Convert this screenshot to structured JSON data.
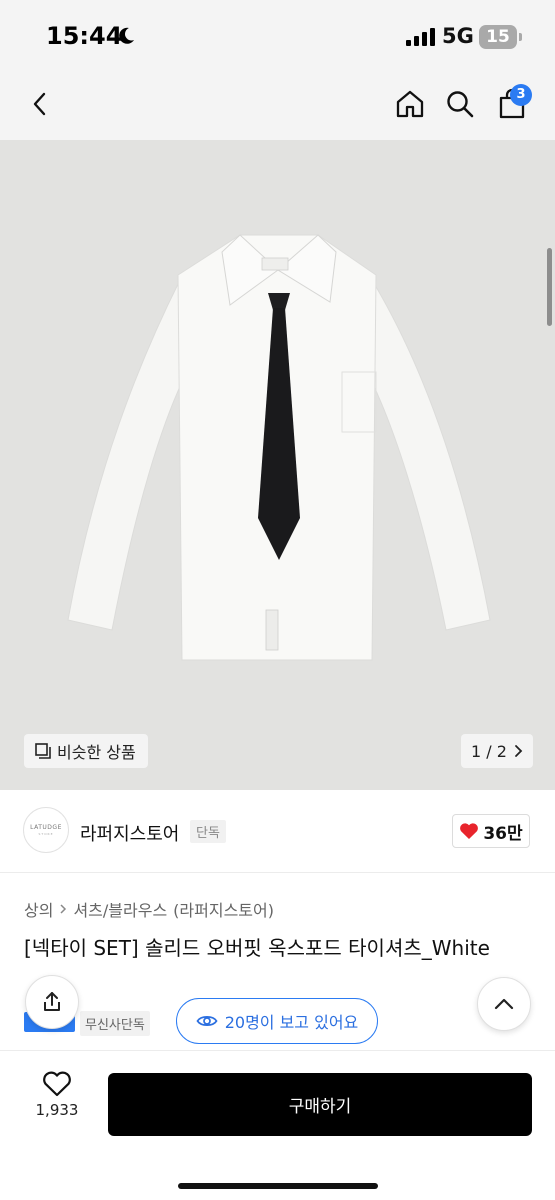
{
  "status_bar": {
    "time": "15:44",
    "network": "5G",
    "battery": "15"
  },
  "nav": {
    "cart_count": "3",
    "icons": [
      "back-chevron-icon",
      "home-icon",
      "search-icon",
      "shopping-bag-icon"
    ]
  },
  "gallery": {
    "similar_label": "비슷한 상품",
    "page_indicator": "1 / 2"
  },
  "store": {
    "logo_text": "LATUDGE",
    "logo_sub": "STORE",
    "name": "라퍼지스토어",
    "exclusive_tag": "단독",
    "likes": "36만"
  },
  "breadcrumb": [
    "상의",
    "셔츠/블라우스",
    "(라퍼지스토어)"
  ],
  "product": {
    "title": "[넥타이 SET] 솔리드 오버핏 옥스포드 타이셔츠_White",
    "exclusive_label": "무신사단독",
    "viewers": "20명이 보고 있어요"
  },
  "bottom_bar": {
    "wish_count": "1,933",
    "buy_label": "구매하기"
  },
  "colors": {
    "accent_blue": "#2b7bf2",
    "heart_red": "#e8242c",
    "buy_black": "#000000",
    "photo_bg": "#e2e2e0"
  }
}
